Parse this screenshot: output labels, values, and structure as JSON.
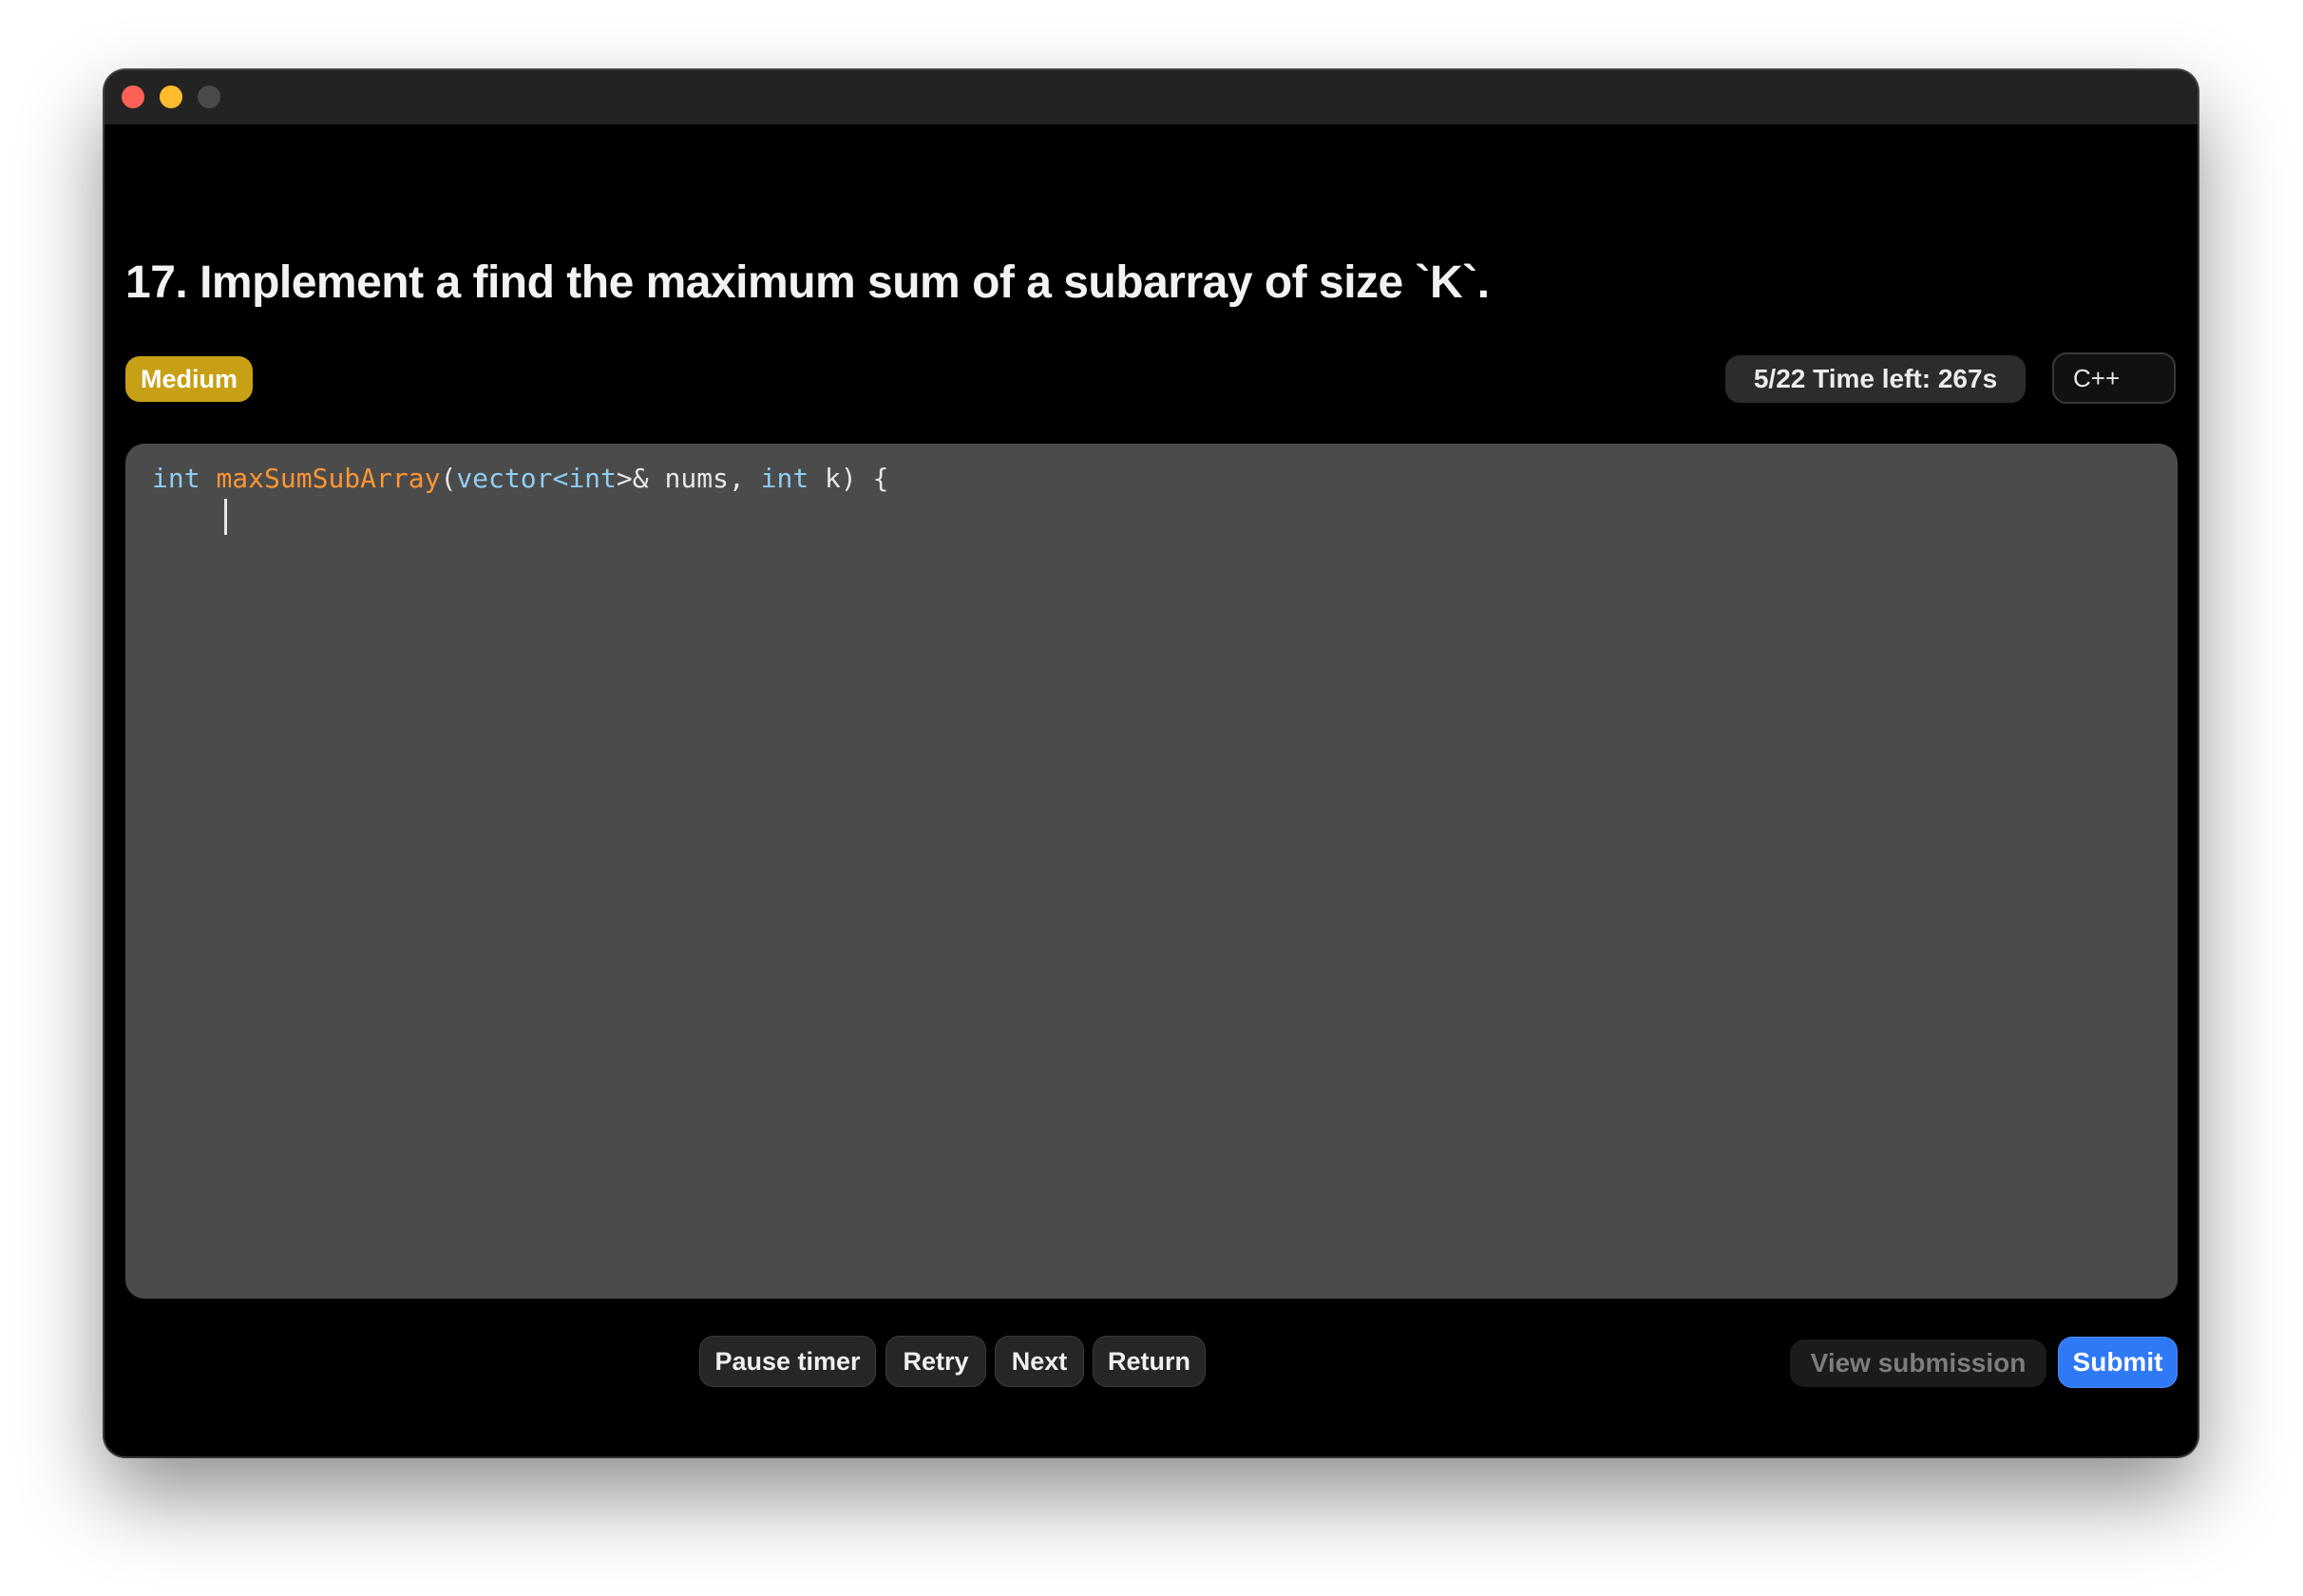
{
  "window": {
    "controls": {
      "close_color": "#fe5f57",
      "minimize_color": "#febc2e",
      "zoom_color": "#4a4a4a"
    }
  },
  "problem": {
    "title": "17. Implement a find the maximum sum of a subarray of size `K`.",
    "difficulty": "Medium",
    "difficulty_color": "#c7a016"
  },
  "status": {
    "progress_timer": "5/22 Time left: 267s"
  },
  "language_select": {
    "selected": "C++"
  },
  "editor": {
    "code": {
      "kw_int": "int",
      "fn_name": "maxSumSubArray",
      "paren_open": "(",
      "type_vector": "vector",
      "lt": "<",
      "type_int": "int",
      "gt_ref": ">& nums, ",
      "kw_int2": "int",
      "rest": " k) {"
    },
    "colors": {
      "keyword": "#8ecdf0",
      "function": "#ff9533",
      "text": "#e6e6e6",
      "background": "#4b4b4b"
    }
  },
  "actions": {
    "pause_label": "Pause timer",
    "retry_label": "Retry",
    "next_label": "Next",
    "return_label": "Return",
    "view_submission_label": "View submission",
    "submit_label": "Submit"
  },
  "accent_color": "#2f79f6"
}
